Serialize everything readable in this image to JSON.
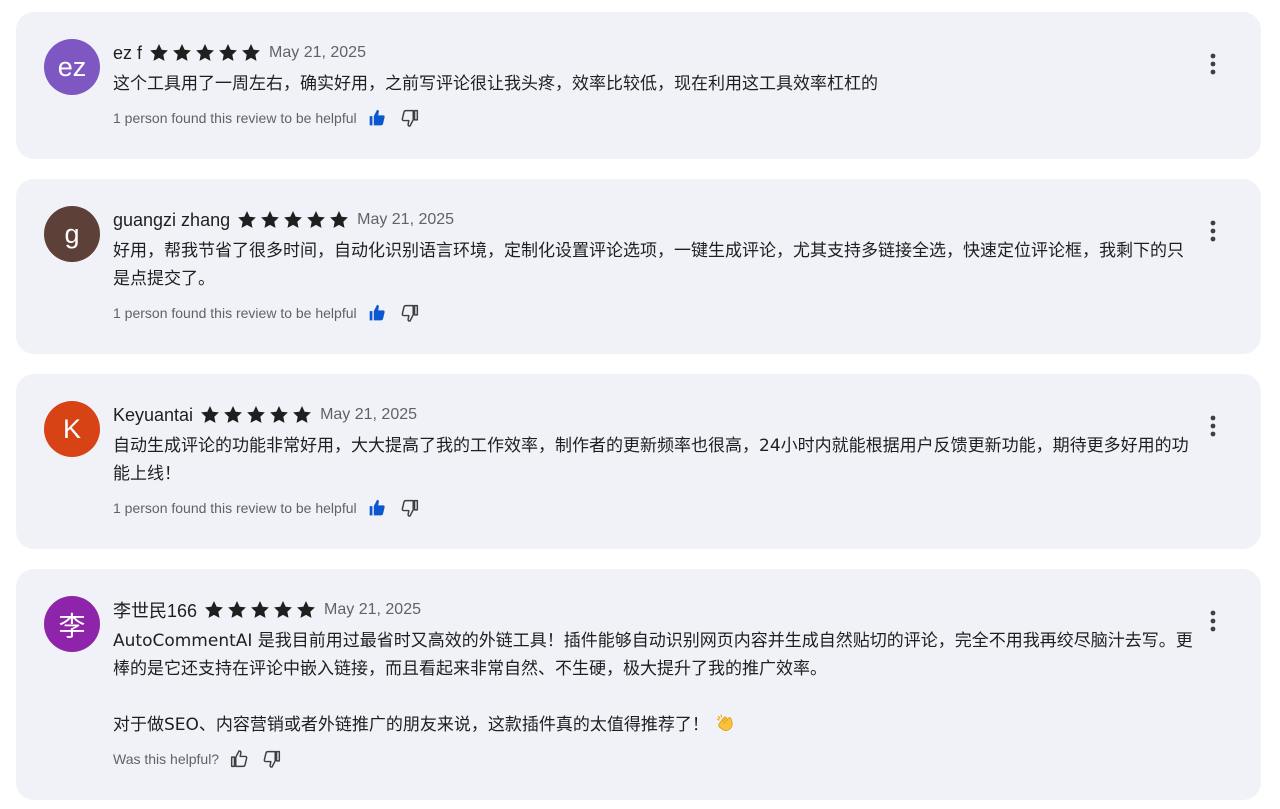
{
  "reviews": [
    {
      "author": "ez f",
      "initials": "ez",
      "avatar_color": "#7e57c2",
      "rating": 5,
      "date": "May 21, 2025",
      "paragraphs": [
        "这个工具用了一周左右，确实好用，之前写评论很让我头疼，效率比较低，现在利用这工具效率杠杠的"
      ],
      "helpful_text": "1 person found this review to be helpful",
      "thumbs_up_active": true
    },
    {
      "author": "guangzi zhang",
      "initials": "g",
      "avatar_color": "#5d4037",
      "rating": 5,
      "date": "May 21, 2025",
      "paragraphs": [
        "好用，帮我节省了很多时间，自动化识别语言环境，定制化设置评论选项，一键生成评论，尤其支持多链接全选，快速定位评论框，我剩下的只是点提交了。"
      ],
      "helpful_text": "1 person found this review to be helpful",
      "thumbs_up_active": true
    },
    {
      "author": "Keyuantai",
      "initials": "K",
      "avatar_color": "#d84315",
      "rating": 5,
      "date": "May 21, 2025",
      "paragraphs": [
        "自动生成评论的功能非常好用，大大提高了我的工作效率，制作者的更新频率也很高，24小时内就能根据用户反馈更新功能，期待更多好用的功能上线！"
      ],
      "helpful_text": "1 person found this review to be helpful",
      "thumbs_up_active": true
    },
    {
      "author": "李世民166",
      "initials": "李",
      "avatar_color": "#8e24aa",
      "rating": 5,
      "date": "May 21, 2025",
      "paragraphs": [
        "AutoCommentAI 是我目前用过最省时又高效的外链工具！插件能够自动识别网页内容并生成自然贴切的评论，完全不用我再绞尽脑汁去写。更棒的是它还支持在评论中嵌入链接，而且看起来非常自然、不生硬，极大提升了我的推广效率。",
        "对于做SEO、内容营销或者外链推广的朋友来说，这款插件真的太值得推荐了！"
      ],
      "trailing_emoji": "clapping-hands",
      "helpful_text": "Was this helpful?",
      "thumbs_up_active": false
    }
  ],
  "colors": {
    "card_bg": "#f0f2f7",
    "star": "#1f1f1f",
    "thumb_active": "#0b57d0",
    "muted_text": "#5f6368"
  },
  "icons": {
    "star": "star-icon",
    "thumbs_up": "thumbs-up-icon",
    "thumbs_down": "thumbs-down-icon",
    "more": "more-vertical-icon",
    "emoji": "clapping-hands-icon"
  }
}
